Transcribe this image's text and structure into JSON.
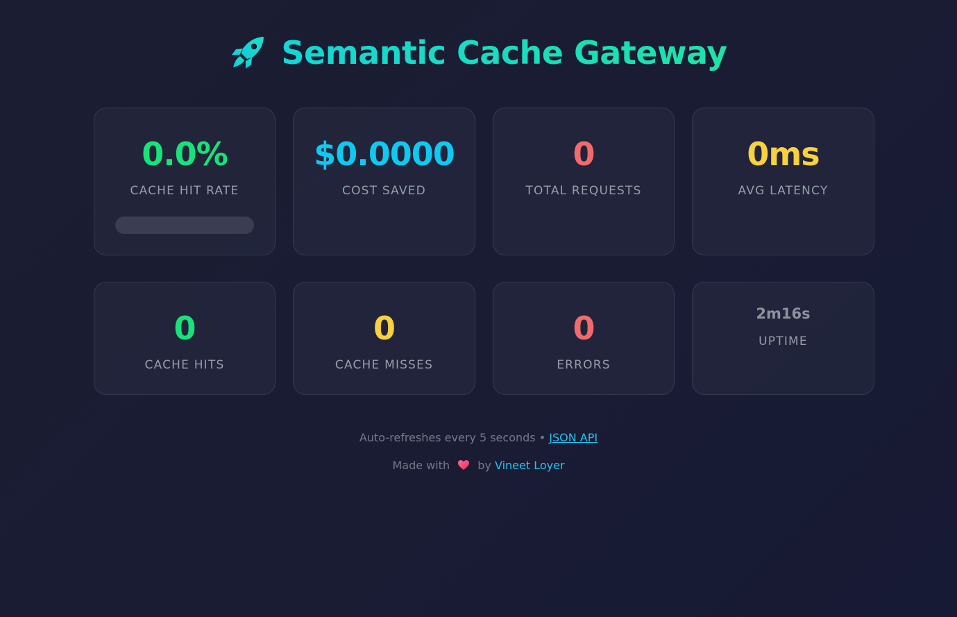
{
  "header": {
    "title": "Semantic Cache Gateway",
    "icon": "rocket-icon"
  },
  "colors": {
    "green": "#17e37a",
    "cyan": "#10c8f0",
    "red": "#f06b6b",
    "yellow": "#f7d13e",
    "muted": "#8f919d"
  },
  "stats_primary": [
    {
      "key": "hit_rate",
      "value": "0.0%",
      "label": "CACHE HIT RATE",
      "color": "green",
      "progress": 0.0
    },
    {
      "key": "cost_saved",
      "value": "$0.0000",
      "label": "COST SAVED",
      "color": "cyan"
    },
    {
      "key": "total_requests",
      "value": "0",
      "label": "TOTAL REQUESTS",
      "color": "red"
    },
    {
      "key": "avg_latency",
      "value": "0ms",
      "label": "AVG LATENCY",
      "color": "yellow"
    }
  ],
  "stats_secondary": [
    {
      "key": "cache_hits",
      "value": "0",
      "label": "CACHE HITS",
      "color": "green"
    },
    {
      "key": "cache_misses",
      "value": "0",
      "label": "CACHE MISSES",
      "color": "yellow"
    },
    {
      "key": "errors",
      "value": "0",
      "label": "ERRORS",
      "color": "red"
    },
    {
      "key": "uptime",
      "value": "2m16s",
      "label": "UPTIME",
      "color": "muted"
    }
  ],
  "footer": {
    "refresh_text": "Auto-refreshes every 5 seconds • ",
    "api_link": "JSON API",
    "made_with": "Made with",
    "by": "by",
    "author": "Vineet Loyer",
    "heart_icon": "heart-icon"
  }
}
